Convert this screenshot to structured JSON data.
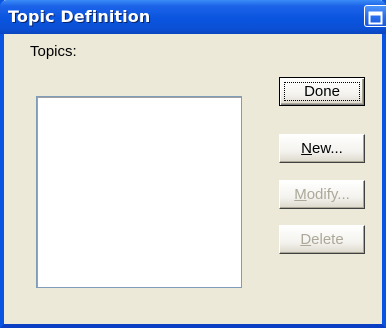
{
  "window": {
    "title": "Topic Definition",
    "title_button_icon": "restore-icon"
  },
  "topics": {
    "label": "Topics:",
    "items": []
  },
  "buttons": {
    "done": {
      "label": "Done",
      "enabled": true,
      "default": true
    },
    "new": {
      "label_mnemonic": "N",
      "label_rest": "ew...",
      "enabled": true
    },
    "modify": {
      "label_mnemonic": "M",
      "label_rest": "odify...",
      "enabled": false
    },
    "delete": {
      "label_mnemonic": "D",
      "label_rest": "elete",
      "enabled": false
    }
  },
  "colors": {
    "titlebar": "#0A55DF",
    "face": "#ECE9D8",
    "disabled_text": "#ACA899"
  }
}
